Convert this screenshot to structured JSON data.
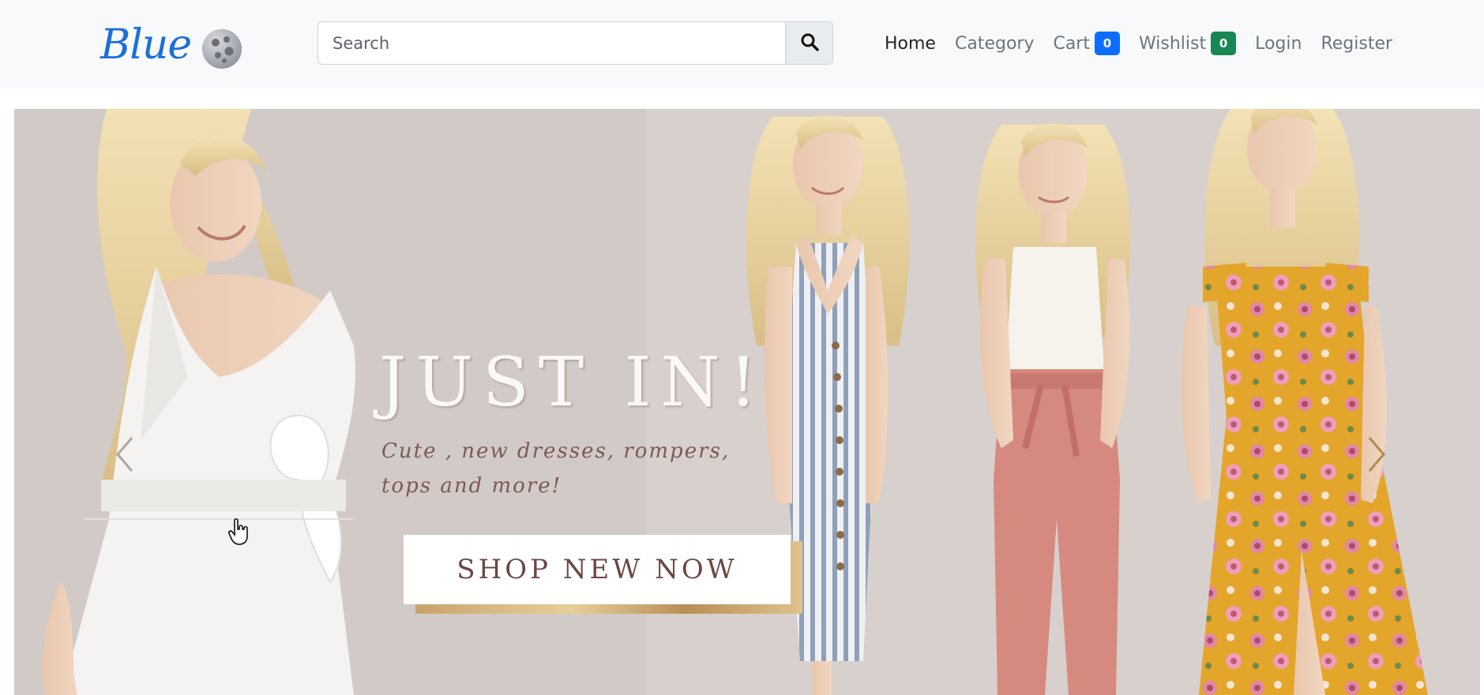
{
  "brand": {
    "name": "Blue",
    "color": "#1b6fd8",
    "icon": "moon-icon"
  },
  "search": {
    "placeholder": "Search",
    "value": "",
    "button_icon": "search-icon"
  },
  "nav": {
    "home": "Home",
    "category": "Category",
    "cart": {
      "label": "Cart",
      "count": "0",
      "badge_color": "#0d6efd"
    },
    "wishlist": {
      "label": "Wishlist",
      "count": "0",
      "badge_color": "#198754"
    },
    "login": "Login",
    "register": "Register"
  },
  "hero": {
    "title": "JUST IN!",
    "subtitle": "Cute , new dresses, rompers, tops and more!",
    "cta": "SHOP NEW NOW",
    "prev_icon": "chevron-left-icon",
    "next_icon": "chevron-right-icon"
  }
}
